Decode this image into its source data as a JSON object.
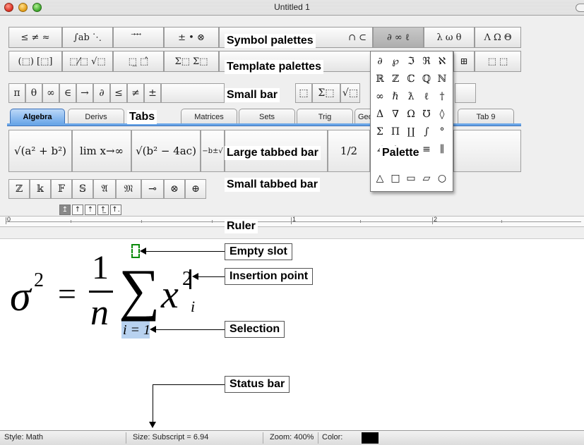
{
  "window": {
    "title": "Untitled 1"
  },
  "symbol_palettes": [
    {
      "label": "≤ ≠ ≈",
      "active": false
    },
    {
      "label": "∫ab ⋱",
      "active": false
    },
    {
      "label": "⃗ ⃗ ⃗",
      "active": false
    },
    {
      "label": "± • ⊗",
      "active": false
    },
    {
      "label": "∩ ⊂",
      "active": false
    },
    {
      "label": "∂ ∞ ℓ",
      "active": true
    },
    {
      "label": "λ ω θ",
      "active": false
    },
    {
      "label": "Λ Ω Θ",
      "active": false
    }
  ],
  "template_palettes": [
    {
      "label": "(⬚) [⬚]"
    },
    {
      "label": "⬚⁄⬚ √⬚"
    },
    {
      "label": "⬚̲ ⬚̂"
    },
    {
      "label": "Σ⬚ Σ⬚"
    },
    {
      "label": "⊞"
    },
    {
      "label": "⬚ ⬚"
    }
  ],
  "small_bar": [
    "π",
    "θ",
    "∞",
    "∈",
    "→",
    "∂",
    "≤",
    "≠",
    "±",
    "⬚",
    "Σ⬚",
    "√⬚"
  ],
  "tabs": [
    {
      "label": "Algebra",
      "active": true
    },
    {
      "label": "Derivs",
      "active": false
    },
    {
      "label": "Matrices",
      "active": false
    },
    {
      "label": "Sets",
      "active": false
    },
    {
      "label": "Trig",
      "active": false
    },
    {
      "label": "Geo",
      "active": false
    },
    {
      "label": "Tab 9",
      "active": false
    }
  ],
  "large_bar": [
    "√(a² + b²)",
    "lim x→∞",
    "√(b² − 4ac)",
    "−b±√",
    "n!",
    "1/2"
  ],
  "small_tabbed_bar": [
    "ℤ",
    "𝕜",
    "𝔽",
    "𝕊",
    "𝔄",
    "𝔐",
    "⊸",
    "⊗",
    "⊕"
  ],
  "palette_popup": {
    "rows": [
      [
        "∂",
        "℘",
        "ℑ",
        "ℜ",
        "ℵ",
        "▦"
      ],
      [
        "ℝ",
        "ℤ",
        "ℂ",
        "ℚ",
        "ℕ"
      ],
      [
        "∞",
        "ℏ",
        "ƛ",
        "ℓ",
        "†"
      ],
      [
        "Δ",
        "∇",
        "Ω",
        "℧",
        "◊"
      ],
      [
        "Σ",
        "Π",
        "∐",
        "∫",
        "°"
      ],
      [
        "∠",
        "⊥",
        "∓",
        "≡",
        "∥"
      ],
      [
        "△",
        "□",
        "▭",
        "▱",
        "○"
      ]
    ]
  },
  "alignment_buttons": [
    "↥",
    "↑",
    "⇡",
    "↑̲",
    "↑."
  ],
  "ruler": {
    "labels": [
      "0",
      "1",
      "2"
    ]
  },
  "equation": {
    "sigma": "σ",
    "sigma_exp": "2",
    "equals": "=",
    "numerator": "1",
    "denominator": "n",
    "summation": "∑",
    "lower_limit": "i = 1",
    "x": "x",
    "x_sup": "2",
    "x_sub": "i"
  },
  "annotations": {
    "symbol_palettes": "Symbol palettes",
    "template_palettes": "Template palettes",
    "small_bar": "Small bar",
    "tabs": "Tabs",
    "large_tabbed_bar": "Large tabbed bar",
    "palette": "Palette",
    "small_tabbed_bar": "Small tabbed bar",
    "ruler": "Ruler",
    "empty_slot": "Empty slot",
    "insertion_point": "Insertion point",
    "selection": "Selection",
    "status_bar": "Status bar"
  },
  "statusbar": {
    "style": "Style: Math",
    "size": "Size: Subscript = 6.94",
    "zoom": "Zoom: 400%",
    "color_label": "Color:",
    "color_value": "#000000"
  }
}
